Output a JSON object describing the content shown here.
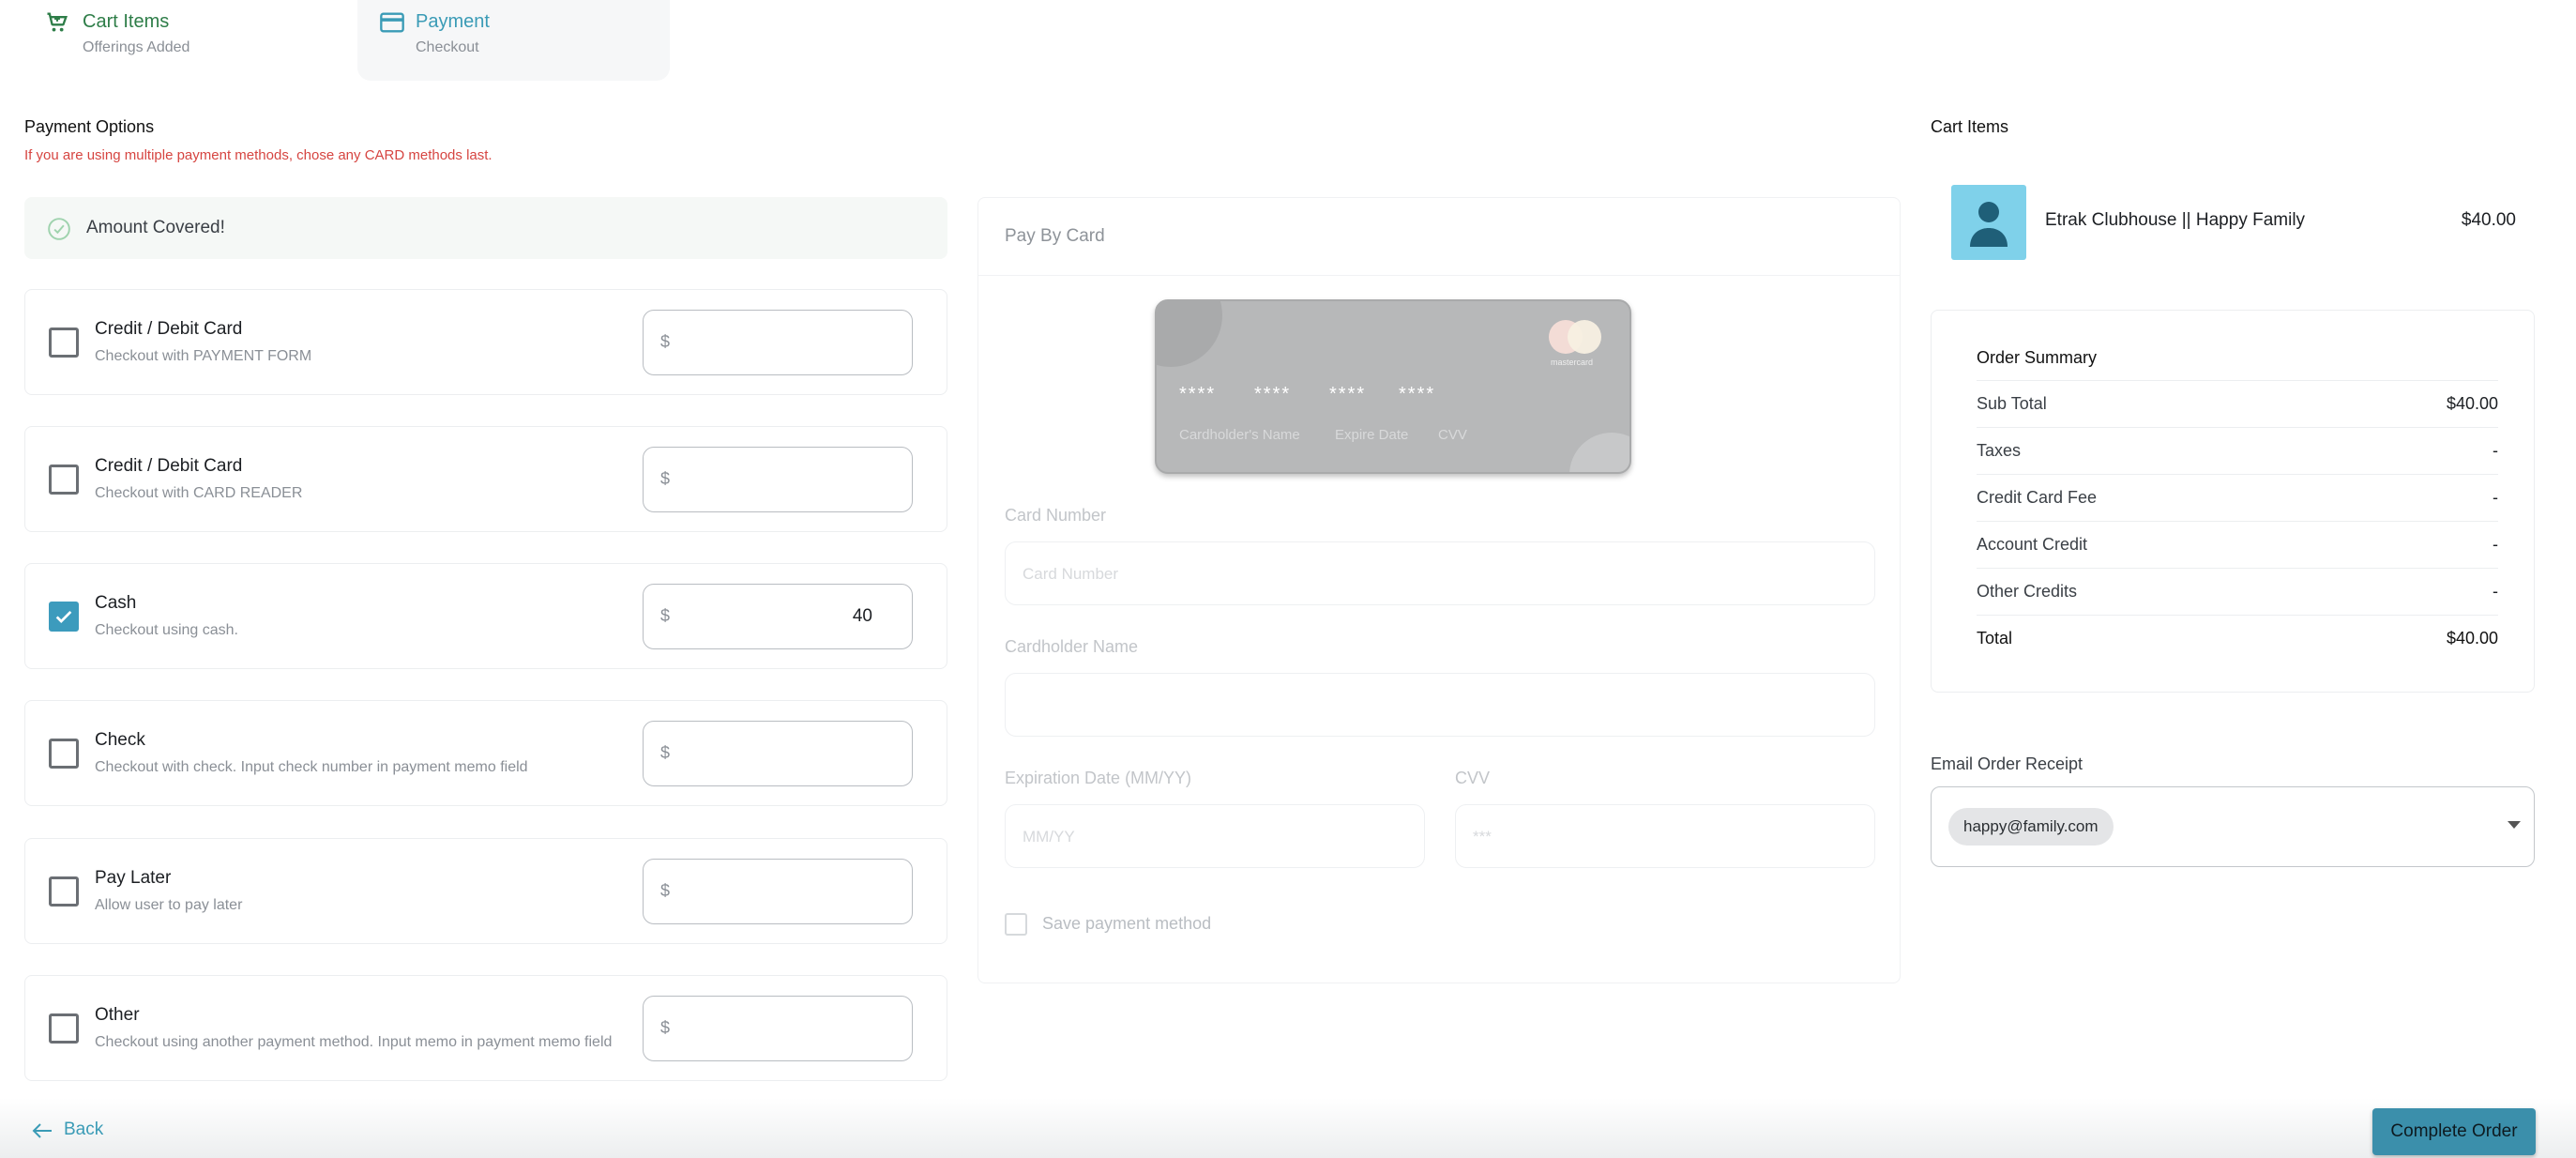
{
  "stepper": {
    "steps": [
      {
        "title": "Cart Items",
        "subtitle": "Offerings Added",
        "icon": "cart-icon"
      },
      {
        "title": "Payment",
        "subtitle": "Checkout",
        "icon": "credit-card-icon"
      }
    ]
  },
  "payment_options": {
    "title": "Payment Options",
    "warning": "If you are using multiple payment methods, chose any CARD methods last.",
    "covered_text": "Amount Covered!",
    "currency": "$",
    "options": [
      {
        "label": "Credit / Debit Card",
        "description": "Checkout with PAYMENT FORM",
        "checked": false,
        "amount": ""
      },
      {
        "label": "Credit / Debit Card",
        "description": "Checkout with CARD READER",
        "checked": false,
        "amount": ""
      },
      {
        "label": "Cash",
        "description": "Checkout using cash.",
        "checked": true,
        "amount": "40"
      },
      {
        "label": "Check",
        "description": "Checkout with check. Input check number in payment memo field",
        "checked": false,
        "amount": ""
      },
      {
        "label": "Pay Later",
        "description": "Allow user to pay later",
        "checked": false,
        "amount": ""
      },
      {
        "label": "Other",
        "description": "Checkout using another payment method. Input memo in payment memo field",
        "checked": false,
        "amount": ""
      }
    ]
  },
  "pay_by_card": {
    "title": "Pay By Card",
    "card_preview": {
      "groups": [
        "****",
        "****",
        "****",
        "****"
      ],
      "brand": "mastercard",
      "holder_label": "Cardholder's Name",
      "expiry_label": "Expire Date",
      "cvv_label": "CVV"
    },
    "card_number": {
      "label": "Card Number",
      "placeholder": "Card Number"
    },
    "holder_name": {
      "label": "Cardholder Name",
      "placeholder": ""
    },
    "expiration": {
      "label": "Expiration Date (MM/YY)",
      "placeholder": "MM/YY"
    },
    "cvv": {
      "label": "CVV",
      "placeholder": "***"
    },
    "save_label": "Save payment method"
  },
  "cart": {
    "title": "Cart Items",
    "items": [
      {
        "name": "Etrak Clubhouse || Happy Family",
        "price": "$40.00"
      }
    ]
  },
  "order_summary": {
    "title": "Order Summary",
    "rows": [
      {
        "label": "Sub Total",
        "value": "$40.00"
      },
      {
        "label": "Taxes",
        "value": "-"
      },
      {
        "label": "Credit Card Fee",
        "value": "-"
      },
      {
        "label": "Account Credit",
        "value": "-"
      },
      {
        "label": "Other Credits",
        "value": "-"
      },
      {
        "label": "Total",
        "value": "$40.00"
      }
    ]
  },
  "email_receipt": {
    "label": "Email Order Receipt",
    "selected": "happy@family.com"
  },
  "footer": {
    "back_label": "Back",
    "complete_label": "Complete Order"
  },
  "colors": {
    "accent": "#3c9bbd",
    "success": "#2e7d48",
    "warning": "#d64541"
  }
}
